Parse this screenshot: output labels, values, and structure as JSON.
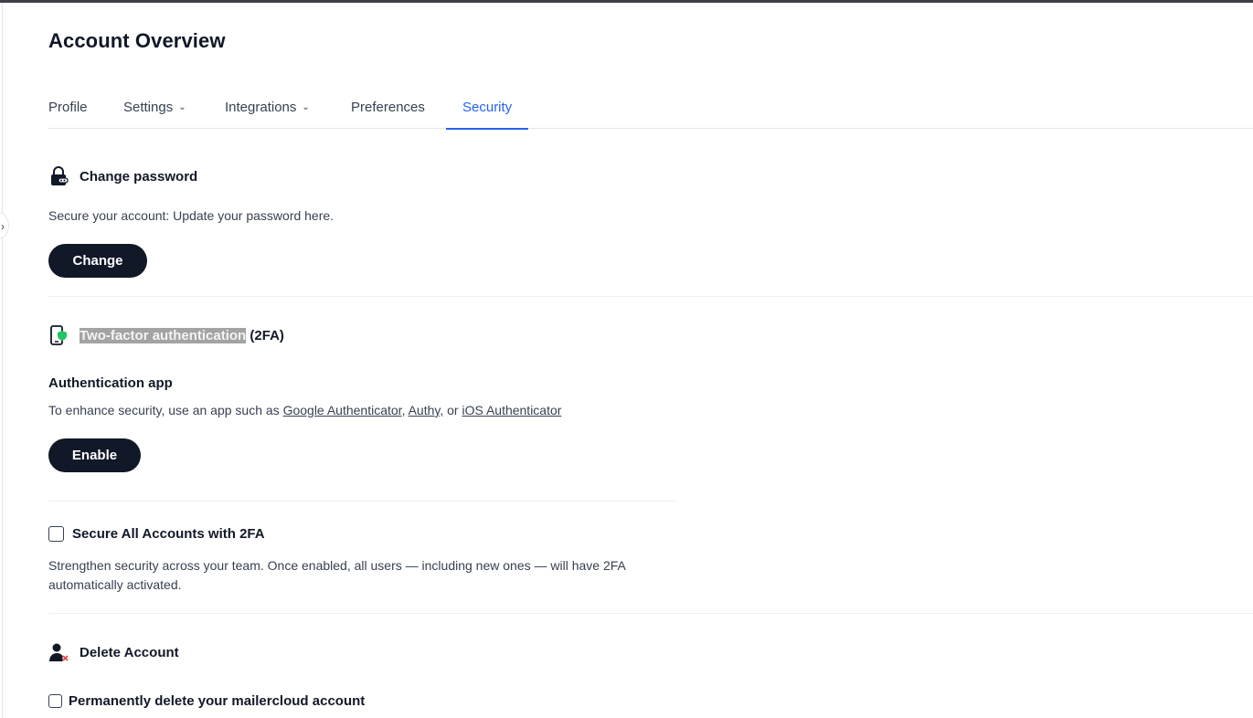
{
  "page": {
    "title": "Account Overview"
  },
  "tabs": [
    {
      "label": "Profile",
      "has_dropdown": false,
      "active": false
    },
    {
      "label": "Settings",
      "has_dropdown": true,
      "active": false
    },
    {
      "label": "Integrations",
      "has_dropdown": true,
      "active": false
    },
    {
      "label": "Preferences",
      "has_dropdown": false,
      "active": false
    },
    {
      "label": "Security",
      "has_dropdown": false,
      "active": true
    }
  ],
  "change_password": {
    "icon": "lock-key-icon",
    "title": "Change password",
    "description": "Secure your account: Update your password here.",
    "button_label": "Change"
  },
  "two_factor": {
    "icon": "phone-shield-icon",
    "title_highlighted": "Two-factor authentication",
    "title_suffix": " (2FA)",
    "auth_app": {
      "title": "Authentication app",
      "description_prefix": "To enhance security, use an app such as ",
      "links": [
        "Google Authenticator",
        "Authy,",
        "iOS Authenticator"
      ],
      "sep1": ", ",
      "sep2": " or ",
      "button_label": "Enable"
    }
  },
  "secure_all": {
    "label": "Secure All Accounts with 2FA",
    "checked": false,
    "description_line1": "Strengthen security across your team. Once enabled, all users — including new ones — will have 2FA",
    "description_line2": "automatically activated."
  },
  "delete_account": {
    "icon": "user-remove-icon",
    "title": "Delete Account",
    "checkbox_label": "Permanently delete your mailercloud account",
    "checked": false
  },
  "colors": {
    "accent": "#2563eb",
    "button_bg": "#111827",
    "shield_green": "#22c55e",
    "delete_red": "#ef4444"
  }
}
